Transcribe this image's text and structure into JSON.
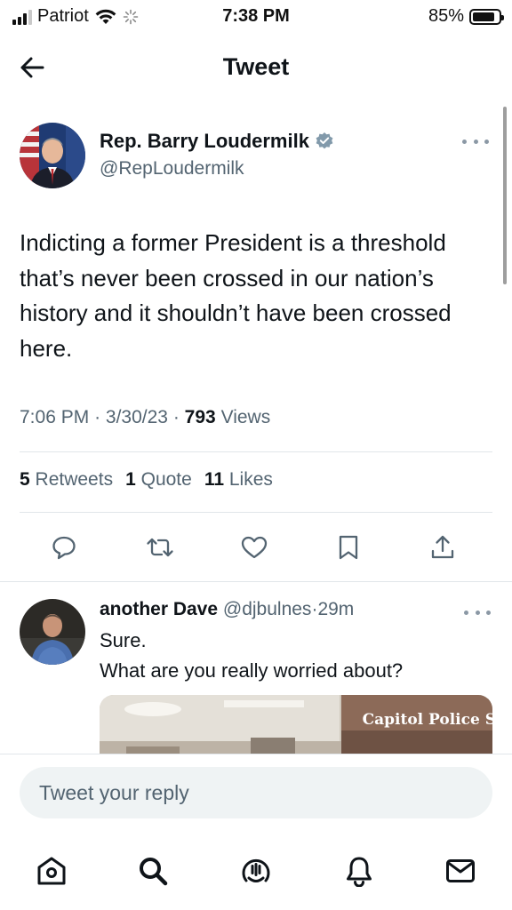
{
  "status_bar": {
    "carrier": "Patriot",
    "time": "7:38 PM",
    "battery_percent": "85%",
    "battery_level": 0.85,
    "signal_bars_on": 3
  },
  "header": {
    "title": "Tweet",
    "back_icon": "arrow-left-icon"
  },
  "tweet": {
    "author_name": "Rep. Barry Loudermilk",
    "author_handle": "@RepLoudermilk",
    "verified": true,
    "text": "Indicting a former President is a threshold that’s never been crossed in our nation’s history and it shouldn’t have been crossed here.",
    "time": "7:06 PM",
    "date": "3/30/23",
    "views_count": "793",
    "views_label": "Views",
    "retweets_count": "5",
    "retweets_label": "Retweets",
    "quotes_count": "1",
    "quotes_label": "Quote",
    "likes_count": "11",
    "likes_label": "Likes"
  },
  "actions": [
    "reply-icon",
    "retweet-icon",
    "like-icon",
    "bookmark-icon",
    "share-icon"
  ],
  "reply": {
    "author_name": "another Dave",
    "author_handle": "@djbulnes",
    "time": "29m",
    "lines": [
      "Sure.",
      "What are you really worried about?"
    ],
    "media_caption": "Capitol Police S"
  },
  "compose": {
    "placeholder": "Tweet your reply"
  },
  "bottom_nav": [
    "home-icon",
    "search-icon",
    "spaces-icon",
    "notifications-icon",
    "messages-icon"
  ],
  "colors": {
    "text_primary": "#0f1419",
    "text_secondary": "#536471",
    "verified_badge": "#829aab",
    "divider": "#e1e6ea",
    "compose_bg": "#eff3f4"
  }
}
